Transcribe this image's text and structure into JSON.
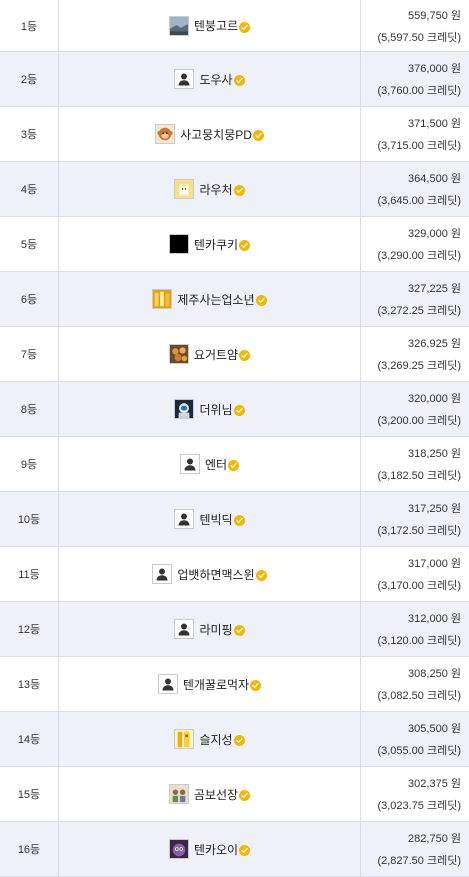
{
  "rows": [
    {
      "rank": "1등",
      "name": "텐붕고르",
      "avatar": "landscape-photo-icon",
      "won": "559,750 원",
      "credit": "(5,597.50 크레딧)"
    },
    {
      "rank": "2등",
      "name": "도우사",
      "avatar": "default-user-icon",
      "won": "376,000 원",
      "credit": "(3,760.00 크레딧)"
    },
    {
      "rank": "3등",
      "name": "사고뭉치뭉PD",
      "avatar": "monkey-icon",
      "won": "371,500 원",
      "credit": "(3,715.00 크레딧)"
    },
    {
      "rank": "4등",
      "name": "라우처",
      "avatar": "yellow-cat-icon",
      "won": "364,500 원",
      "credit": "(3,645.00 크레딧)"
    },
    {
      "rank": "5등",
      "name": "텐카쿠키",
      "avatar": "black-square-icon",
      "won": "329,000 원",
      "credit": "(3,290.00 크레딧)"
    },
    {
      "rank": "6등",
      "name": "제주사는업소년",
      "avatar": "gold-photo-icon",
      "won": "327,225 원",
      "credit": "(3,272.25 크레딧)"
    },
    {
      "rank": "7등",
      "name": "요거트얌",
      "avatar": "food-photo-icon",
      "won": "326,925 원",
      "credit": "(3,269.25 크레딧)"
    },
    {
      "rank": "8등",
      "name": "더위님",
      "avatar": "astronaut-icon",
      "won": "320,000 원",
      "credit": "(3,200.00 크레딧)"
    },
    {
      "rank": "9등",
      "name": "엔터",
      "avatar": "default-user-icon",
      "won": "318,250 원",
      "credit": "(3,182.50 크레딧)"
    },
    {
      "rank": "10등",
      "name": "텐빅딕",
      "avatar": "default-user-icon",
      "won": "317,250 원",
      "credit": "(3,172.50 크레딧)"
    },
    {
      "rank": "11등",
      "name": "업뱃하면맥스윈",
      "avatar": "default-user-icon",
      "won": "317,000 원",
      "credit": "(3,170.00 크레딧)"
    },
    {
      "rank": "12등",
      "name": "라미핑",
      "avatar": "default-user-icon",
      "won": "312,000 원",
      "credit": "(3,120.00 크레딧)"
    },
    {
      "rank": "13등",
      "name": "텐개꿀로먹자",
      "avatar": "default-user-icon",
      "won": "308,250 원",
      "credit": "(3,082.50 크레딧)"
    },
    {
      "rank": "14등",
      "name": "슬지성",
      "avatar": "gold-statue-icon",
      "won": "305,500 원",
      "credit": "(3,055.00 크레딧)"
    },
    {
      "rank": "15등",
      "name": "곰보선장",
      "avatar": "character-photo-icon",
      "won": "302,375 원",
      "credit": "(3,023.75 크레딧)"
    },
    {
      "rank": "16등",
      "name": "텐카오이",
      "avatar": "purple-creature-icon",
      "won": "282,750 원",
      "credit": "(2,827.50 크레딧)"
    }
  ],
  "colors": {
    "row_alt": "#eef1f8",
    "border": "#d9dce6",
    "verified_badge": "#f2b705"
  }
}
